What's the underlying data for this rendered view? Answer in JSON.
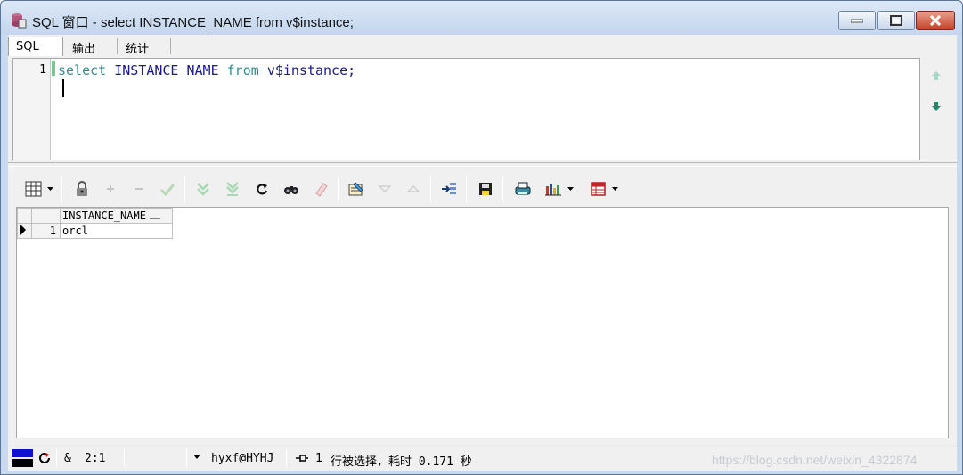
{
  "window": {
    "title": "SQL 窗口 - select INSTANCE_NAME from v$instance;"
  },
  "tabs": [
    {
      "label": "SQL",
      "active": true
    },
    {
      "label": "输出",
      "active": false
    },
    {
      "label": "统计",
      "active": false
    }
  ],
  "editor": {
    "line_number": "1",
    "code": {
      "kw1": "select",
      "ident": "INSTANCE_NAME",
      "kw2": "from",
      "table": "v$instance;"
    }
  },
  "toolbar": {
    "icons": [
      "grid-view-icon",
      "lock-icon",
      "add-record-icon",
      "delete-record-icon",
      "post-changes-icon",
      "fetch-next-icon",
      "fetch-last-icon",
      "refresh-icon",
      "find-icon",
      "clear-icon",
      "query-by-example-icon",
      "next-record-icon",
      "previous-record-icon",
      "export-icon",
      "save-icon",
      "print-icon",
      "chart-icon",
      "single-record-icon"
    ]
  },
  "grid": {
    "columns": [
      "INSTANCE_NAME"
    ],
    "rows": [
      {
        "num": "1",
        "cells": [
          "orcl"
        ]
      }
    ]
  },
  "statusbar": {
    "amp": "&",
    "position": "2:1",
    "connection": "hyxf@HYHJ",
    "message_count": "1",
    "message": "行被选择，耗时 0.171 秒"
  },
  "watermark": "https://blog.csdn.net/weixin_4322874",
  "colors": {
    "keyword": "#2f8f8f",
    "identifier": "#1a1a8a",
    "title_bar": "#c4d6ee",
    "close_button": "#c2412a"
  }
}
